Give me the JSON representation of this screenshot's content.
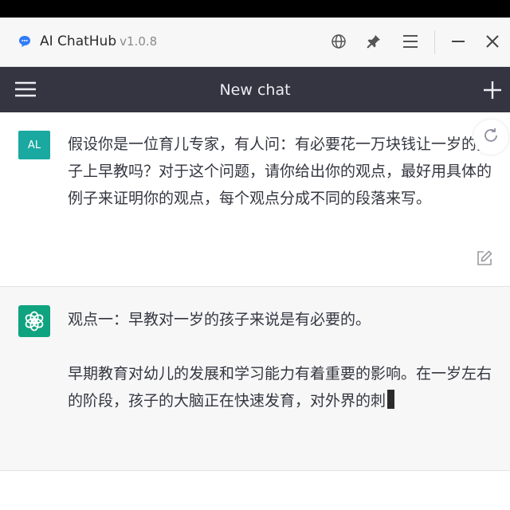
{
  "app": {
    "title": "AI ChatHub",
    "version": "v1.0.8",
    "icons": [
      "chat-bubble-icon",
      "globe-icon",
      "pin-icon",
      "menu-icon",
      "minimize-icon",
      "close-icon"
    ]
  },
  "chat": {
    "title": "New chat",
    "icons": [
      "hamburger-icon",
      "plus-icon"
    ]
  },
  "messages": [
    {
      "role": "user",
      "avatar_label": "AL",
      "text": "假设你是一位育儿专家，有人问：有必要花一万块钱让一岁的孩子上早教吗？对于这个问题，请你给出你的观点，最好用具体的例子来证明你的观点，每个观点分成不同的段落来写。"
    },
    {
      "role": "assistant",
      "paragraphs": [
        "观点一：早教对一岁的孩子来说是有必要的。",
        "早期教育对幼儿的发展和学习能力有着重要的影响。在一岁左右的阶段，孩子的大脑正在快速发育，对外界的刺"
      ]
    }
  ],
  "colors": {
    "header_bg": "#343541",
    "user_avatar": "#19a9a0",
    "bot_avatar": "#10a37f",
    "bot_msg_bg": "#f7f7f8"
  }
}
